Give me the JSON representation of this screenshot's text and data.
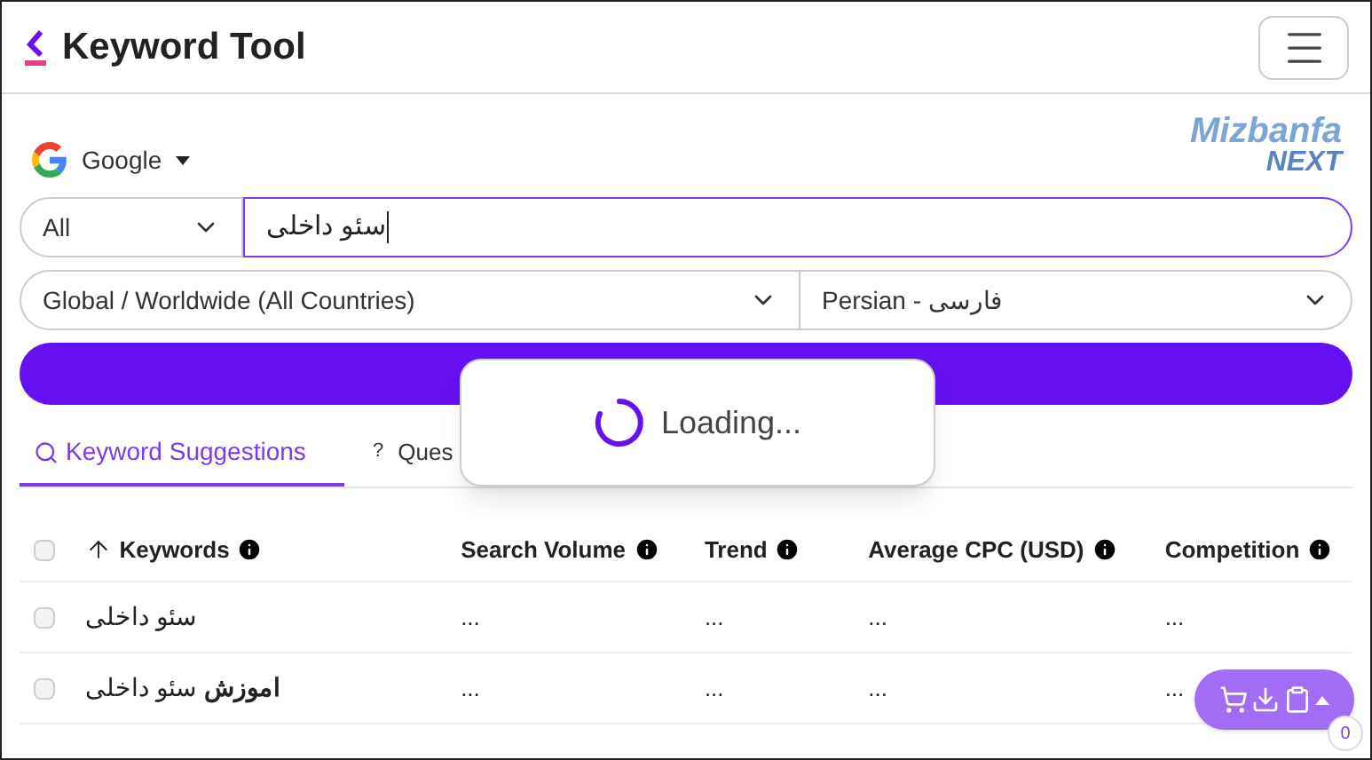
{
  "header": {
    "title": "Keyword Tool"
  },
  "engine": {
    "label": "Google"
  },
  "partner_logo": {
    "name": "Mizbanfa",
    "sub": "NEXT"
  },
  "search": {
    "mode": "All",
    "value": "سئو داخلی"
  },
  "location": {
    "value": "Global / Worldwide (All Countries)"
  },
  "language": {
    "value": "Persian - فارسی"
  },
  "loading": {
    "text": "Loading..."
  },
  "tabs": [
    {
      "label": "Keyword Suggestions",
      "selected": true
    },
    {
      "label": "Ques",
      "icon": "?",
      "selected": false
    }
  ],
  "table": {
    "select_all_checked": false,
    "columns": [
      {
        "label": "Keywords",
        "sorted": true
      },
      {
        "label": "Search Volume",
        "sorted": false
      },
      {
        "label": "Trend",
        "sorted": false
      },
      {
        "label": "Average CPC (USD)",
        "sorted": false
      },
      {
        "label": "Competition",
        "sorted": false
      }
    ],
    "rows": [
      {
        "checked": false,
        "cells": [
          "سئو داخلی",
          "...",
          "...",
          "...",
          "..."
        ]
      },
      {
        "checked": false,
        "cells": [
          "**اموزش** سئو داخلی",
          "...",
          "...",
          "...",
          "..."
        ]
      }
    ]
  },
  "cart": {
    "count": "0"
  }
}
